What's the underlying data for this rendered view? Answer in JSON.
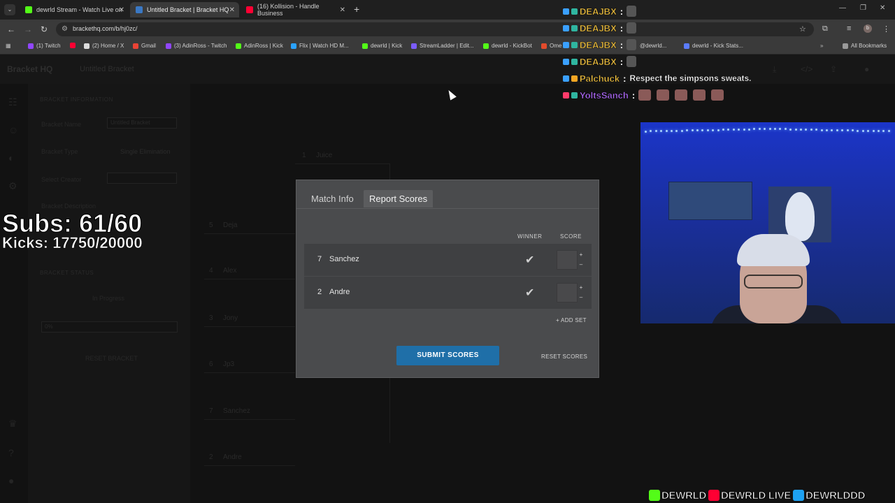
{
  "browser": {
    "tabs": [
      {
        "title": "dewrld Stream - Watch Live on",
        "color": "#53fc18"
      },
      {
        "title": "Untitled Bracket | Bracket HQ",
        "color": "#3a78c4"
      },
      {
        "title": "(16) Kollision - Handle Business",
        "color": "#ff0033"
      }
    ],
    "address": "brackethq.com/b/hj0zc/",
    "bookmarks": [
      {
        "label": "(1) Twitch",
        "color": "#9146ff"
      },
      {
        "label": "",
        "color": "#ff0033"
      },
      {
        "label": "(2) Home / X",
        "color": "#dddddd"
      },
      {
        "label": "Gmail",
        "color": "#ea4335"
      },
      {
        "label": "(3) AdinRoss - Twitch",
        "color": "#9146ff"
      },
      {
        "label": "AdinRoss | Kick",
        "color": "#53fc18"
      },
      {
        "label": "Flix | Watch HD M...",
        "color": "#2aa2ff"
      },
      {
        "label": "dewrld | Kick",
        "color": "#53fc18"
      },
      {
        "label": "StreamLadder | Edit...",
        "color": "#7b5cff"
      },
      {
        "label": "dewrld - KickBot",
        "color": "#53fc18"
      },
      {
        "label": "Ome",
        "color": "#e34b2c"
      },
      {
        "label": "@dewrld...",
        "color": "#888888"
      },
      {
        "label": "dewrld - Kick Stats...",
        "color": "#5b7cff"
      }
    ],
    "all_bookmarks": "All Bookmarks"
  },
  "app": {
    "logo": "Bracket HQ",
    "title": "Untitled Bracket",
    "sidebar": {
      "info_heading": "BRACKET INFORMATION",
      "name_label": "Bracket Name",
      "name_value": "Untitled Bracket",
      "type_label": "Bracket Type",
      "type_value": "Single Elimination",
      "creator_label": "Select Creator",
      "description_label": "Bracket Description",
      "status_heading": "BRACKET STATUS",
      "status_value": "In Progress",
      "progress_text": "0%",
      "reset_label": "RESET BRACKET"
    },
    "seeds": [
      {
        "num": "1",
        "name": "Juice"
      },
      {
        "num": "5",
        "name": "Deja"
      },
      {
        "num": "4",
        "name": "Alex"
      },
      {
        "num": "3",
        "name": "Jony"
      },
      {
        "num": "6",
        "name": "Jp3"
      },
      {
        "num": "7",
        "name": "Sanchez"
      },
      {
        "num": "2",
        "name": "Andre"
      }
    ]
  },
  "modal": {
    "tabs": [
      "Match Info",
      "Report Scores"
    ],
    "active_tab": "Report Scores",
    "winner_header": "WINNER",
    "score_header": "SCORE",
    "rows": [
      {
        "seed": "7",
        "name": "Sanchez",
        "score": ""
      },
      {
        "seed": "2",
        "name": "Andre",
        "score": ""
      }
    ],
    "add_set": "+ ADD SET",
    "submit": "SUBMIT SCORES",
    "reset": "RESET SCORES"
  },
  "overlay": {
    "subs": "Subs: 61/60",
    "kicks": "Kicks: 17750/20000",
    "chat": [
      {
        "user": "DEAJBX",
        "color": "#f5c542",
        "message": "",
        "emotes": 1
      },
      {
        "user": "DEAJBX",
        "color": "#f5c542",
        "message": "",
        "emotes": 1
      },
      {
        "user": "DEAJBX",
        "color": "#f5c542",
        "message": "",
        "emotes": 1
      },
      {
        "user": "DEAJBX",
        "color": "#f5c542",
        "message": "",
        "emotes": 1
      },
      {
        "user": "Palchuck",
        "color": "#f5c542",
        "message": "Respect the simpsons sweats.",
        "emotes": 0
      },
      {
        "user": "YoltsSanch",
        "color": "#b36cff",
        "message": "",
        "emotes": 5
      }
    ],
    "socials": [
      {
        "handle": "DEWRLD",
        "color": "#53fc18"
      },
      {
        "handle": "DEWRLD LIVE",
        "color": "#ff0033"
      },
      {
        "handle": "DEWRLDDD",
        "color": "#1da1f2"
      }
    ]
  }
}
